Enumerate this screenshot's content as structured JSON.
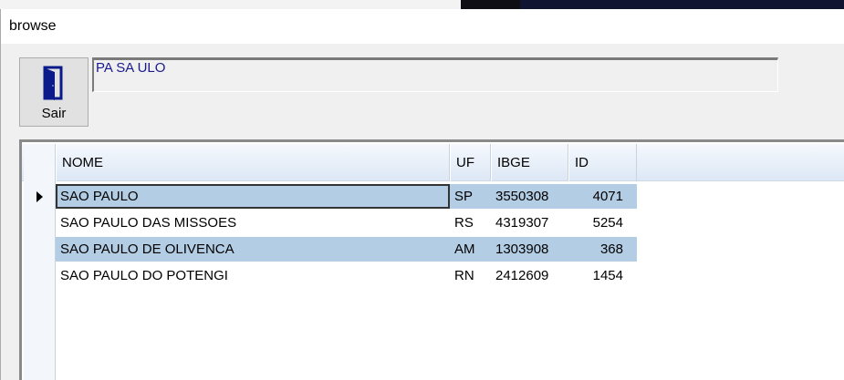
{
  "window": {
    "title": "browse"
  },
  "toolbar": {
    "exit_label": "Sair"
  },
  "search": {
    "value": "PA SA ULO"
  },
  "grid": {
    "columns": [
      "NOME",
      "UF",
      "IBGE",
      "ID"
    ],
    "rows": [
      {
        "nome": "SAO PAULO",
        "uf": "SP",
        "ibge": "3550308",
        "id": "4071",
        "selected": true
      },
      {
        "nome": "SAO PAULO DAS MISSOES",
        "uf": "RS",
        "ibge": "4319307",
        "id": "5254",
        "selected": false
      },
      {
        "nome": "SAO PAULO DE OLIVENCA",
        "uf": "AM",
        "ibge": "1303908",
        "id": "368",
        "selected": true
      },
      {
        "nome": "SAO PAULO DO POTENGI",
        "uf": "RN",
        "ibge": "2412609",
        "id": "1454",
        "selected": false
      }
    ]
  },
  "colors": {
    "selection": "#b3cde4",
    "input_text": "#1a1a8c",
    "door_icon": "#0a1a8a"
  }
}
